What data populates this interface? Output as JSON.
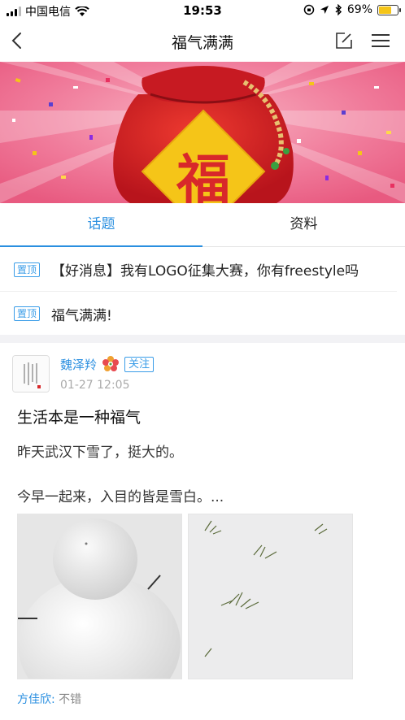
{
  "status_bar": {
    "carrier": "中国电信",
    "time": "19:53",
    "battery": "69%",
    "battery_level": 0.69
  },
  "nav": {
    "title": "福气满满",
    "icons": [
      "back-icon",
      "edit-icon",
      "menu-icon"
    ]
  },
  "banner": {
    "character": "福"
  },
  "tabs": [
    {
      "label": "话题",
      "active": true
    },
    {
      "label": "资料",
      "active": false
    }
  ],
  "pinned": [
    {
      "badge": "置顶",
      "text": "【好消息】我有LOGO征集大赛，你有freestyle吗"
    },
    {
      "badge": "置顶",
      "text": "福气满满!"
    }
  ],
  "post": {
    "author": "魏泽羚",
    "follow_label": "关注",
    "time": "01-27 12:05",
    "title": "生活本是一种福气",
    "paragraph1": "昨天武汉下雪了，挺大的。",
    "paragraph2": "今早一起来，入目的皆是雪白。...",
    "comment": {
      "user": "方佳欣:",
      "text": "不错"
    }
  },
  "colors": {
    "accent": "#2a8fe0",
    "banner_red": "#d8282a",
    "banner_pink": "#f07a9a",
    "gold": "#f5c518"
  }
}
